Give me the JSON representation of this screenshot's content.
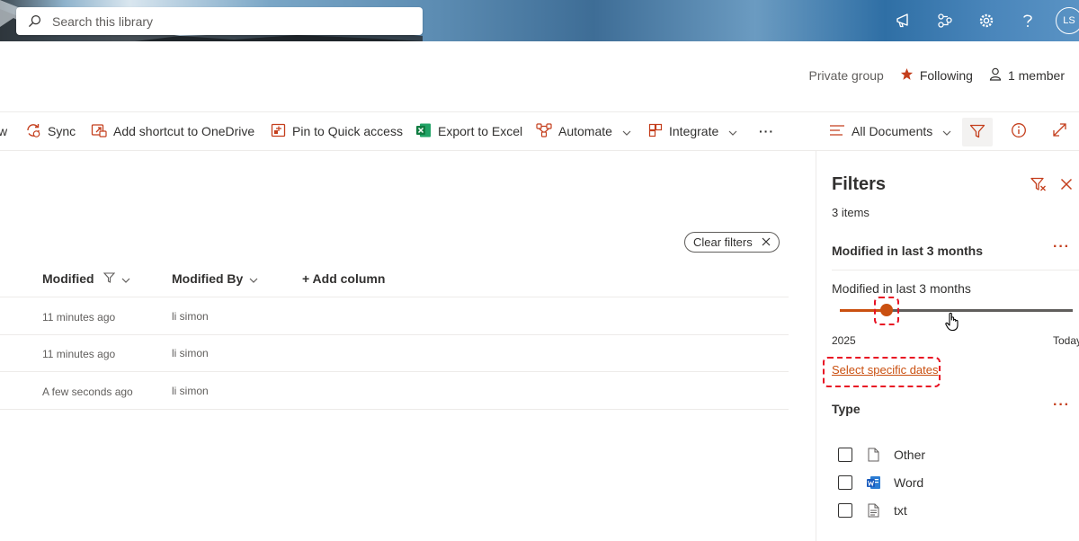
{
  "header": {
    "search_placeholder": "Search this library",
    "avatar_initials": "LS"
  },
  "group": {
    "privacy": "Private group",
    "following": "Following",
    "members": "1 member"
  },
  "commandbar": {
    "partial_item": "w",
    "sync": "Sync",
    "add_shortcut": "Add shortcut to OneDrive",
    "pin": "Pin to Quick access",
    "export": "Export to Excel",
    "automate": "Automate",
    "integrate": "Integrate",
    "more": "···",
    "view": "All Documents"
  },
  "list": {
    "clear_filters": "Clear filters",
    "columns": {
      "modified": "Modified",
      "modified_by": "Modified By",
      "add_column": "+ Add column"
    },
    "rows": [
      {
        "modified": "11 minutes ago",
        "modified_by": "li simon"
      },
      {
        "modified": "11 minutes ago",
        "modified_by": "li simon"
      },
      {
        "modified": "A few seconds ago",
        "modified_by": "li simon"
      }
    ]
  },
  "filters_panel": {
    "title": "Filters",
    "item_count": "3 items",
    "modified_section_title": "Modified in last 3 months",
    "slider_label": "Modified in last 3 months",
    "slider_start": "2025",
    "slider_end": "Today",
    "select_dates_link": "Select specific dates",
    "type_section_title": "Type",
    "types": [
      {
        "label": "Other",
        "checked": false
      },
      {
        "label": "Word",
        "checked": false
      },
      {
        "label": "txt",
        "checked": false
      }
    ]
  },
  "colors": {
    "accent": "#ca5010",
    "highlight": "#e81123"
  }
}
